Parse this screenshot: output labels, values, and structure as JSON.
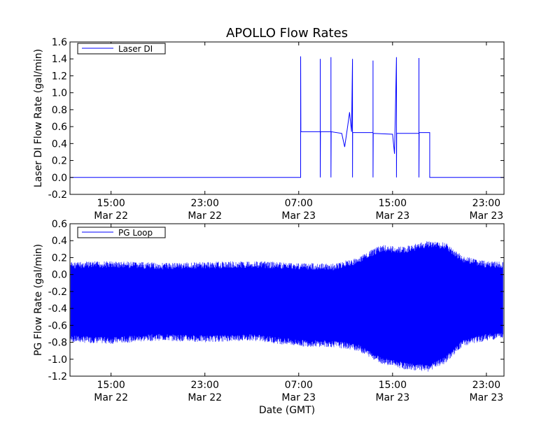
{
  "window": {
    "title": "APOLLO Flow Rates"
  },
  "chart_data": [
    {
      "type": "line",
      "title": "APOLLO Flow Rates",
      "xlabel": "",
      "ylabel": "Laser DI Flow Rate (gal/min)",
      "xlim": [
        "2013-03-22 11:30",
        "2013-03-24 00:30"
      ],
      "ylim": [
        -0.2,
        1.6
      ],
      "grid": false,
      "legend": {
        "position": "top-left",
        "entries": [
          {
            "label": "Laser DI",
            "color": "#0000ff"
          }
        ]
      },
      "x_ticks": [
        {
          "time": "2013-03-22 15:00",
          "line1": "15:00",
          "line2": "Mar 22"
        },
        {
          "time": "2013-03-22 23:00",
          "line1": "23:00",
          "line2": "Mar 22"
        },
        {
          "time": "2013-03-23 07:00",
          "line1": "07:00",
          "line2": "Mar 23"
        },
        {
          "time": "2013-03-23 15:00",
          "line1": "15:00",
          "line2": "Mar 23"
        },
        {
          "time": "2013-03-23 23:00",
          "line1": "23:00",
          "line2": "Mar 23"
        }
      ],
      "y_ticks": [
        "-0.2",
        "0.0",
        "0.2",
        "0.4",
        "0.6",
        "0.8",
        "1.0",
        "1.2",
        "1.4",
        "1.6"
      ],
      "series": [
        {
          "name": "Laser DI",
          "color": "#0000ff",
          "points": [
            [
              "2013-03-22 11:30",
              0.0
            ],
            [
              "2013-03-23 07:10",
              0.0
            ],
            [
              "2013-03-23 07:10",
              1.43
            ],
            [
              "2013-03-23 07:11",
              0.54
            ],
            [
              "2013-03-23 08:50",
              0.54
            ],
            [
              "2013-03-23 08:50",
              1.4
            ],
            [
              "2013-03-23 08:50",
              0.0
            ],
            [
              "2013-03-23 08:51",
              0.54
            ],
            [
              "2013-03-23 09:45",
              0.54
            ],
            [
              "2013-03-23 09:45",
              1.42
            ],
            [
              "2013-03-23 09:45",
              0.0
            ],
            [
              "2013-03-23 09:46",
              0.54
            ],
            [
              "2013-03-23 10:40",
              0.52
            ],
            [
              "2013-03-23 10:55",
              0.36
            ],
            [
              "2013-03-23 11:10",
              0.6
            ],
            [
              "2013-03-23 11:20",
              0.77
            ],
            [
              "2013-03-23 11:30",
              0.54
            ],
            [
              "2013-03-23 11:35",
              1.4
            ],
            [
              "2013-03-23 11:35",
              0.0
            ],
            [
              "2013-03-23 11:36",
              0.53
            ],
            [
              "2013-03-23 13:20",
              0.53
            ],
            [
              "2013-03-23 13:20",
              1.38
            ],
            [
              "2013-03-23 13:20",
              0.0
            ],
            [
              "2013-03-23 13:21",
              0.52
            ],
            [
              "2013-03-23 15:00",
              0.51
            ],
            [
              "2013-03-23 15:10",
              0.28
            ],
            [
              "2013-03-23 15:20",
              1.42
            ],
            [
              "2013-03-23 15:20",
              0.0
            ],
            [
              "2013-03-23 15:21",
              0.52
            ],
            [
              "2013-03-23 17:15",
              0.52
            ],
            [
              "2013-03-23 17:15",
              1.41
            ],
            [
              "2013-03-23 17:15",
              0.0
            ],
            [
              "2013-03-23 17:16",
              0.53
            ],
            [
              "2013-03-23 18:10",
              0.53
            ],
            [
              "2013-03-23 18:10",
              0.0
            ],
            [
              "2013-03-24 00:30",
              0.0
            ]
          ]
        }
      ]
    },
    {
      "type": "line",
      "title": "",
      "xlabel": "Date (GMT)",
      "ylabel": "PG Flow Rate (gal/min)",
      "xlim": [
        "2013-03-22 11:30",
        "2013-03-24 00:30"
      ],
      "ylim": [
        -1.2,
        0.6
      ],
      "grid": false,
      "legend": {
        "position": "top-left",
        "entries": [
          {
            "label": "PG Loop",
            "color": "#0000ff"
          }
        ]
      },
      "x_ticks": [
        {
          "time": "2013-03-22 15:00",
          "line1": "15:00",
          "line2": "Mar 22"
        },
        {
          "time": "2013-03-22 23:00",
          "line1": "23:00",
          "line2": "Mar 22"
        },
        {
          "time": "2013-03-23 07:00",
          "line1": "07:00",
          "line2": "Mar 23"
        },
        {
          "time": "2013-03-23 15:00",
          "line1": "15:00",
          "line2": "Mar 23"
        },
        {
          "time": "2013-03-23 23:00",
          "line1": "23:00",
          "line2": "Mar 23"
        }
      ],
      "y_ticks": [
        "-1.2",
        "-1.0",
        "-0.8",
        "-0.6",
        "-0.4",
        "-0.2",
        "0.0",
        "0.2",
        "0.4",
        "0.6"
      ],
      "series": [
        {
          "name": "PG Loop",
          "color": "#0000ff",
          "envelope": [
            {
              "time": "2013-03-22 11:30",
              "max": 0.15,
              "min": -0.8
            },
            {
              "time": "2013-03-22 15:00",
              "max": 0.16,
              "min": -0.82
            },
            {
              "time": "2013-03-22 19:00",
              "max": 0.14,
              "min": -0.78
            },
            {
              "time": "2013-03-22 23:00",
              "max": 0.15,
              "min": -0.8
            },
            {
              "time": "2013-03-23 03:00",
              "max": 0.16,
              "min": -0.78
            },
            {
              "time": "2013-03-23 07:00",
              "max": 0.14,
              "min": -0.85
            },
            {
              "time": "2013-03-23 10:00",
              "max": 0.13,
              "min": -0.86
            },
            {
              "time": "2013-03-23 12:00",
              "max": 0.2,
              "min": -0.9
            },
            {
              "time": "2013-03-23 14:00",
              "max": 0.35,
              "min": -1.05
            },
            {
              "time": "2013-03-23 16:00",
              "max": 0.33,
              "min": -1.12
            },
            {
              "time": "2013-03-23 18:00",
              "max": 0.4,
              "min": -1.15
            },
            {
              "time": "2013-03-23 19:30",
              "max": 0.38,
              "min": -1.05
            },
            {
              "time": "2013-03-23 21:00",
              "max": 0.22,
              "min": -0.85
            },
            {
              "time": "2013-03-23 23:00",
              "max": 0.16,
              "min": -0.78
            },
            {
              "time": "2013-03-24 00:30",
              "max": 0.15,
              "min": -0.76
            }
          ]
        }
      ]
    }
  ]
}
